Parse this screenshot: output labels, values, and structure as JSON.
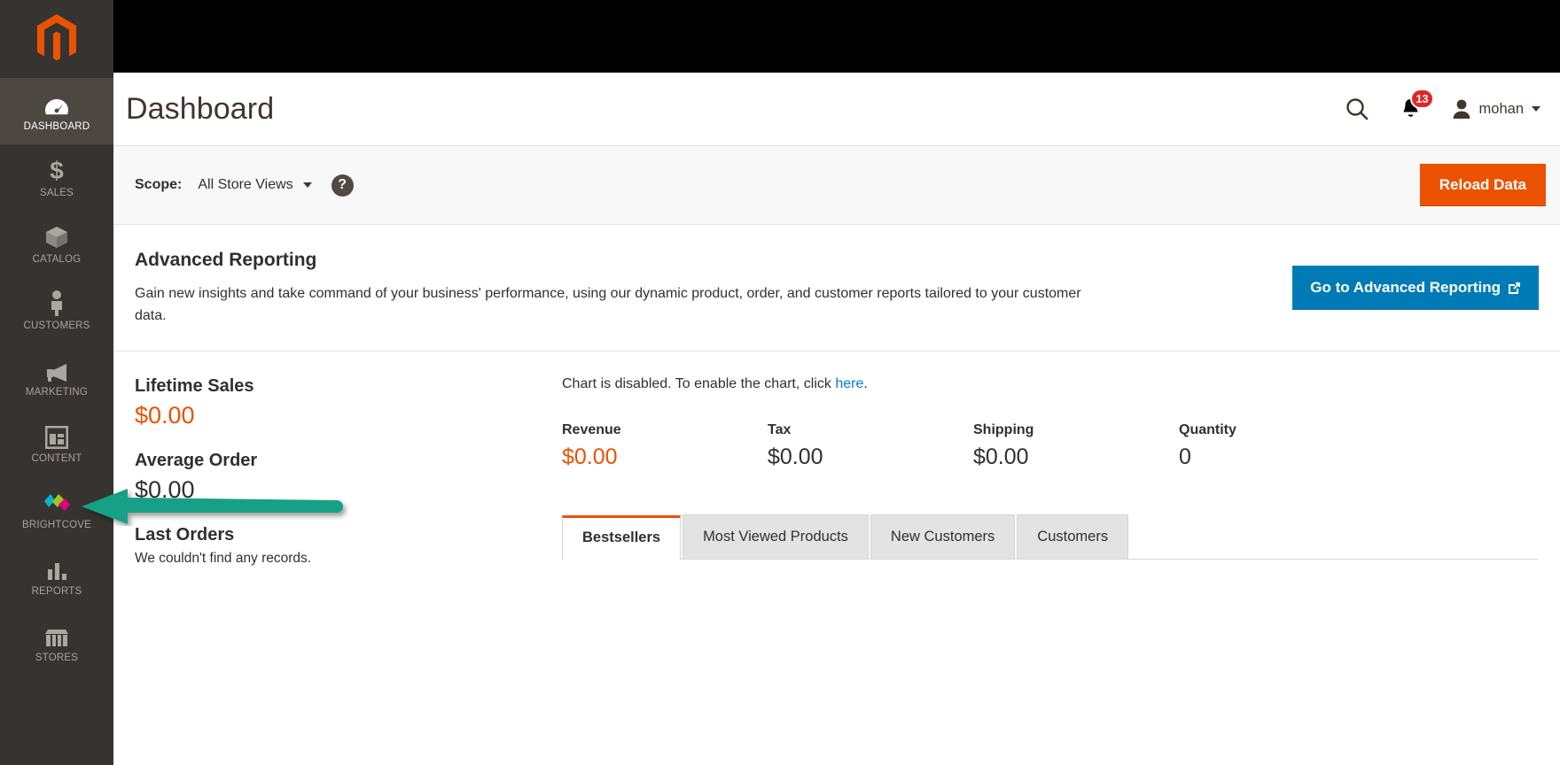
{
  "sidebar": {
    "logo": "magento-logo",
    "items": [
      {
        "label": "DASHBOARD",
        "icon": "gauge-icon",
        "active": true
      },
      {
        "label": "SALES",
        "icon": "dollar-icon",
        "active": false
      },
      {
        "label": "CATALOG",
        "icon": "box-icon",
        "active": false
      },
      {
        "label": "CUSTOMERS",
        "icon": "person-icon",
        "active": false
      },
      {
        "label": "MARKETING",
        "icon": "megaphone-icon",
        "active": false
      },
      {
        "label": "CONTENT",
        "icon": "layout-icon",
        "active": false
      },
      {
        "label": "BRIGHTCOVE",
        "icon": "brightcove-icon",
        "active": false
      },
      {
        "label": "REPORTS",
        "icon": "bar-chart-icon",
        "active": false
      },
      {
        "label": "STORES",
        "icon": "storefront-icon",
        "active": false
      }
    ]
  },
  "header": {
    "title": "Dashboard",
    "search_icon": "search-icon",
    "notifications_icon": "bell-icon",
    "notifications_count": "13",
    "user_icon": "user-avatar-icon",
    "user_name": "mohan",
    "caret_icon": "chevron-down-icon"
  },
  "scope": {
    "label": "Scope:",
    "value": "All Store Views",
    "help_icon": "question-mark-icon",
    "reload_label": "Reload Data"
  },
  "advanced_reporting": {
    "title": "Advanced Reporting",
    "description": "Gain new insights and take command of your business' performance, using our dynamic product, order, and customer reports tailored to your customer data.",
    "button_label": "Go to Advanced Reporting",
    "button_icon": "external-link-icon"
  },
  "stats": [
    {
      "title": "Lifetime Sales",
      "value": "$0.00",
      "accent": true
    },
    {
      "title": "Average Order",
      "value": "$0.00",
      "accent": false
    },
    {
      "title": "Last Orders",
      "note": "We couldn't find any records."
    }
  ],
  "chart": {
    "notice_prefix": "Chart is disabled. To enable the chart, click ",
    "notice_link": "here",
    "notice_suffix": "."
  },
  "totals": [
    {
      "label": "Revenue",
      "value": "$0.00",
      "accent": true
    },
    {
      "label": "Tax",
      "value": "$0.00",
      "accent": false
    },
    {
      "label": "Shipping",
      "value": "$0.00",
      "accent": false
    },
    {
      "label": "Quantity",
      "value": "0",
      "accent": false
    }
  ],
  "tabs": [
    {
      "label": "Bestsellers",
      "active": true
    },
    {
      "label": "Most Viewed Products",
      "active": false
    },
    {
      "label": "New Customers",
      "active": false
    },
    {
      "label": "Customers",
      "active": false
    }
  ],
  "annotation": {
    "type": "arrow",
    "color": "#16a085",
    "points_to": "sidebar-item-brightcove"
  },
  "colors": {
    "brand_orange": "#eb5202",
    "link_blue": "#007bdb",
    "button_blue": "#007bb6",
    "sidebar_bg": "#373330",
    "badge_red": "#e22626"
  }
}
